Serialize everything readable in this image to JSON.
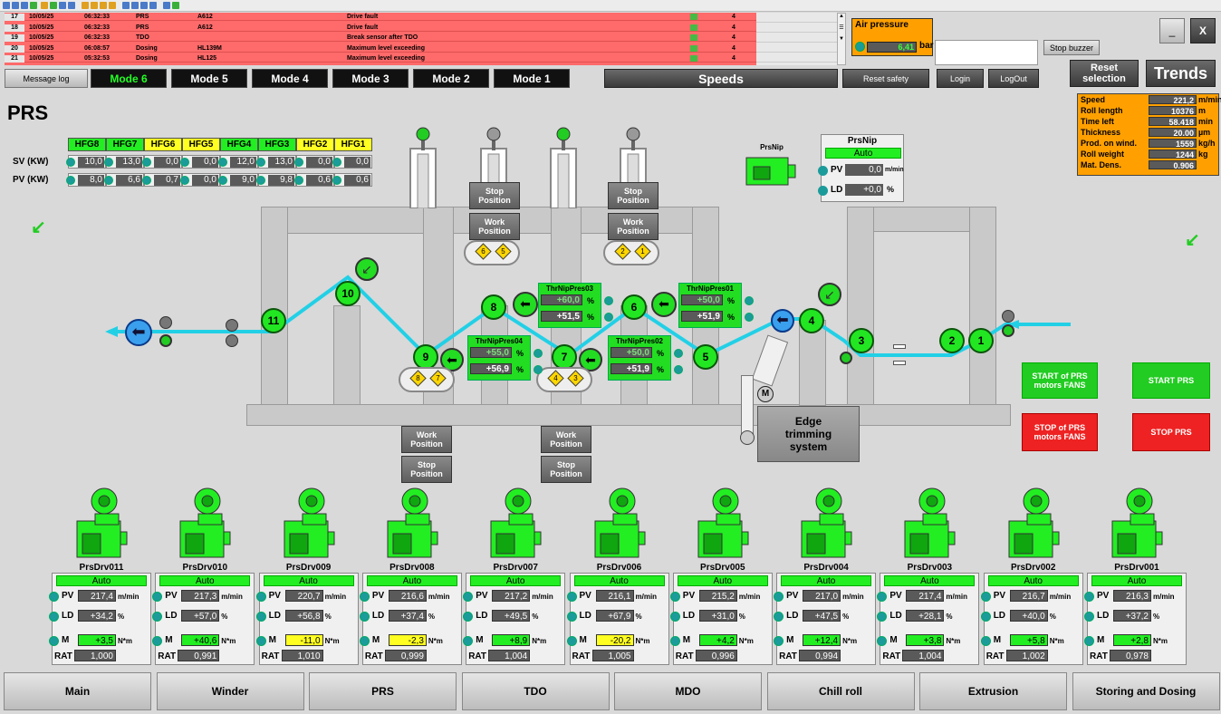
{
  "alarms": [
    {
      "n": "17",
      "date": "10/05/25",
      "time": "06:32:33",
      "area": "PRS",
      "tag": "A612",
      "msg": "Drive fault",
      "cnt": "4"
    },
    {
      "n": "18",
      "date": "10/05/25",
      "time": "06:32:33",
      "area": "PRS",
      "tag": "A612",
      "msg": "Drive fault",
      "cnt": "4"
    },
    {
      "n": "19",
      "date": "10/05/25",
      "time": "06:32:33",
      "area": "TDO",
      "tag": "",
      "msg": "Break sensor after TDO",
      "cnt": "4"
    },
    {
      "n": "20",
      "date": "10/05/25",
      "time": "06:08:57",
      "area": "Dosing",
      "tag": "HL139M",
      "msg": "Maximum level exceeding",
      "cnt": "4"
    },
    {
      "n": "21",
      "date": "10/05/25",
      "time": "05:32:53",
      "area": "Dosing",
      "tag": "HL125",
      "msg": "Maximum level exceeding",
      "cnt": "4"
    }
  ],
  "air": {
    "label": "Air pressure",
    "value": "6,41",
    "unit": "bar"
  },
  "top": {
    "stop_buzzer": "Stop buzzer",
    "minimize": "_",
    "close": "X",
    "reset_selection": "Reset selection",
    "trends": "Trends",
    "message_log": "Message log",
    "speeds": "Speeds",
    "reset_safety": "Reset safety",
    "login": "Login",
    "logout": "LogOut"
  },
  "modes": [
    "Mode 6",
    "Mode 5",
    "Mode 4",
    "Mode 3",
    "Mode 2",
    "Mode 1"
  ],
  "page_title": "PRS",
  "stats": [
    {
      "label": "Speed",
      "value": "221,2",
      "unit": "m/min"
    },
    {
      "label": "Roll length",
      "value": "10376",
      "unit": "m"
    },
    {
      "label": "Time left",
      "value": "58.418",
      "unit": "min"
    },
    {
      "label": "Thickness",
      "value": "20.00",
      "unit": "µm"
    },
    {
      "label": "Prod. on wind.",
      "value": "1559",
      "unit": "kg/h"
    },
    {
      "label": "Roll weight",
      "value": "1244",
      "unit": "kg"
    },
    {
      "label": "Mat. Dens.",
      "value": "0.906",
      "unit": ""
    }
  ],
  "hfg": {
    "headers": [
      "HFG8",
      "HFG7",
      "HFG6",
      "HFG5",
      "HFG4",
      "HFG3",
      "HFG2",
      "HFG1"
    ],
    "header_colors": [
      "#22ee22",
      "#22ee22",
      "#ffff22",
      "#ffff22",
      "#22ee22",
      "#22ee22",
      "#ffff22",
      "#ffff22"
    ],
    "sv_label": "SV (KW)",
    "pv_label": "PV (KW)",
    "sv": [
      "10,0",
      "13,0",
      "0,0",
      "0,0",
      "12,0",
      "13,0",
      "0,0",
      "0,0"
    ],
    "pv": [
      "8,0",
      "6,6",
      "0,7",
      "0,0",
      "9,0",
      "9,8",
      "0,6",
      "0,6"
    ]
  },
  "prsnip": {
    "motor_label": "PrsNip",
    "title": "PrsNip",
    "mode": "Auto",
    "pv_label": "PV",
    "pv": "0,0",
    "pv_unit": "m/min",
    "ld_label": "LD",
    "ld": "+0,0",
    "ld_unit": "%"
  },
  "rolls": [
    "11",
    "10",
    "9",
    "8",
    "7",
    "6",
    "5",
    "4",
    "3",
    "2",
    "1"
  ],
  "positions": {
    "stop": "Stop Position",
    "work": "Work Position"
  },
  "nips": [
    [
      "6",
      "5"
    ],
    [
      "2",
      "1"
    ],
    [
      "8",
      "7"
    ],
    [
      "4",
      "3"
    ]
  ],
  "pressures": [
    {
      "name": "ThrNipPres03",
      "sv": "+60,0",
      "pv": "+51,5"
    },
    {
      "name": "ThrNipPres01",
      "sv": "+50,0",
      "pv": "+51,9"
    },
    {
      "name": "ThrNipPres04",
      "sv": "+55,0",
      "pv": "+56,9"
    },
    {
      "name": "ThrNipPres02",
      "sv": "+50,0",
      "pv": "+51,9"
    }
  ],
  "edge": {
    "label": "Edge trimming system",
    "motor": "M"
  },
  "actions": {
    "start_fans": "START of PRS motors FANS",
    "start_prs": "START PRS",
    "stop_fans": "STOP of PRS motors FANS",
    "stop_prs": "STOP PRS"
  },
  "drives": [
    {
      "name": "PrsDrv011",
      "mode": "Auto",
      "pv": "217,4",
      "ld": "+34,2",
      "m": "+3,5",
      "m_color": "grn",
      "rat": "1,000"
    },
    {
      "name": "PrsDrv010",
      "mode": "Auto",
      "pv": "217,3",
      "ld": "+57,0",
      "m": "+40,6",
      "m_color": "grn",
      "rat": "0,991"
    },
    {
      "name": "PrsDrv009",
      "mode": "Auto",
      "pv": "220,7",
      "ld": "+56,8",
      "m": "-11,0",
      "m_color": "yel",
      "rat": "1,010"
    },
    {
      "name": "PrsDrv008",
      "mode": "Auto",
      "pv": "216,6",
      "ld": "+37,4",
      "m": "-2,3",
      "m_color": "yel",
      "rat": "0,999"
    },
    {
      "name": "PrsDrv007",
      "mode": "Auto",
      "pv": "217,2",
      "ld": "+49,5",
      "m": "+8,9",
      "m_color": "grn",
      "rat": "1,004"
    },
    {
      "name": "PrsDrv006",
      "mode": "Auto",
      "pv": "216,1",
      "ld": "+67,9",
      "m": "-20,2",
      "m_color": "yel",
      "rat": "1,005"
    },
    {
      "name": "PrsDrv005",
      "mode": "Auto",
      "pv": "215,2",
      "ld": "+31,0",
      "m": "+4,2",
      "m_color": "grn",
      "rat": "0,996"
    },
    {
      "name": "PrsDrv004",
      "mode": "Auto",
      "pv": "217,0",
      "ld": "+47,5",
      "m": "+12,4",
      "m_color": "grn",
      "rat": "0,994"
    },
    {
      "name": "PrsDrv003",
      "mode": "Auto",
      "pv": "217,4",
      "ld": "+28,1",
      "m": "+3,8",
      "m_color": "grn",
      "rat": "1,004"
    },
    {
      "name": "PrsDrv002",
      "mode": "Auto",
      "pv": "216,7",
      "ld": "+40,0",
      "m": "+5,8",
      "m_color": "grn",
      "rat": "1,002"
    },
    {
      "name": "PrsDrv001",
      "mode": "Auto",
      "pv": "216,3",
      "ld": "+37,2",
      "m": "+2,8",
      "m_color": "grn",
      "rat": "0,978"
    }
  ],
  "drive_labels": {
    "pv": "PV",
    "ld": "LD",
    "m": "M",
    "rat": "RAT",
    "pv_unit": "m/min",
    "ld_unit": "%",
    "m_unit": "N*m"
  },
  "nav": [
    "Main",
    "Winder",
    "PRS",
    "TDO",
    "MDO",
    "Chill roll",
    "Extrusion",
    "Storing and Dosing"
  ]
}
